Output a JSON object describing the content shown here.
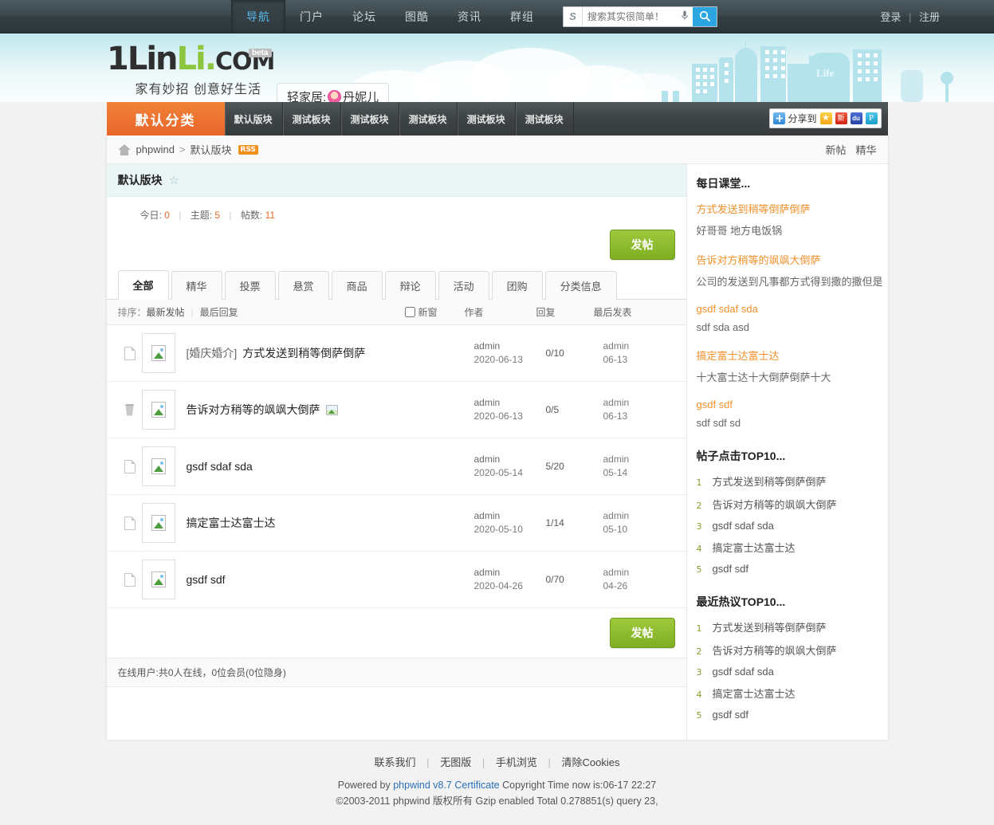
{
  "topbar": {
    "nav": [
      {
        "label": "导航",
        "active": true
      },
      {
        "label": "门户",
        "active": false
      },
      {
        "label": "论坛",
        "active": false
      },
      {
        "label": "图酷",
        "active": false
      },
      {
        "label": "资讯",
        "active": false
      },
      {
        "label": "群组",
        "active": false
      }
    ],
    "search": {
      "engine_letter": "S",
      "placeholder": "搜索其实很简单！",
      "value": "",
      "mic_icon": "microphone-icon",
      "button_icon": "search-icon"
    },
    "login": "登录",
    "separator": "|",
    "register": "注册"
  },
  "banner": {
    "logo": {
      "part1": "1",
      "part2": "Lin",
      "part3": "Li",
      "dot": ".",
      "com": "COM",
      "beta": "beta",
      "subtitle": "家有妙招 创意好生活"
    },
    "tagline_prefix": "轻家居:",
    "tagline_name": "丹妮儿",
    "life_text": "Life"
  },
  "forum_nav": {
    "home": "默认分类",
    "items": [
      {
        "label": "默认版块"
      },
      {
        "label": "测试板块"
      },
      {
        "label": "测试板块"
      },
      {
        "label": "测试板块"
      },
      {
        "label": "测试板块"
      },
      {
        "label": "测试板块"
      }
    ],
    "share": {
      "label": "分享到",
      "icons": [
        "share-plus-icon",
        "favorite-star-icon",
        "weibo-icon",
        "baidu-icon",
        "qzone-icon"
      ],
      "weibo_glyph": "新",
      "baidu_glyph": "du",
      "qzone_glyph": "P",
      "star_glyph": "★"
    }
  },
  "breadcrumb": {
    "home_icon": "home-icon",
    "root": "phpwind",
    "separator": ">",
    "current": "默认版块",
    "rss": "RSS",
    "right_links": [
      {
        "label": "新帖"
      },
      {
        "label": "精华"
      }
    ]
  },
  "forum": {
    "title": "默认版块",
    "favorite_icon": "star-outline-icon",
    "stats": [
      {
        "label": "今日:",
        "value": "0"
      },
      {
        "label": "主题:",
        "value": "5"
      },
      {
        "label": "帖数:",
        "value": "11"
      }
    ],
    "stat_divider": "|",
    "post_button": "发帖",
    "post_button_bottom": "发帖",
    "tabs": [
      {
        "label": "全部",
        "active": true
      },
      {
        "label": "精华",
        "active": false
      },
      {
        "label": "投票",
        "active": false
      },
      {
        "label": "悬赏",
        "active": false
      },
      {
        "label": "商品",
        "active": false
      },
      {
        "label": "辩论",
        "active": false
      },
      {
        "label": "活动",
        "active": false
      },
      {
        "label": "团购",
        "active": false
      },
      {
        "label": "分类信息",
        "active": false
      }
    ],
    "list_head": {
      "sort_label": "排序：",
      "sort_new": "最新发帖",
      "sort_sep": "|",
      "sort_reply": "最后回复",
      "newwin": "新窗",
      "author": "作者",
      "reply": "回复",
      "last_post": "最后发表"
    },
    "threads": [
      {
        "state_icon": "document-icon",
        "thumb_icon": "broken-image-icon",
        "prefix": "[婚庆婚介]",
        "title": "方式发送到稍等倒萨倒萨",
        "has_image_badge": false,
        "author": "admin",
        "author_date": "2020-06-13",
        "reply": "0/10",
        "last_author": "admin",
        "last_date": "06-13"
      },
      {
        "state_icon": "trash-icon",
        "thumb_icon": "broken-image-icon",
        "prefix": "",
        "title": "告诉对方稍等的飒飒大倒萨",
        "has_image_badge": true,
        "author": "admin",
        "author_date": "2020-06-13",
        "reply": "0/5",
        "last_author": "admin",
        "last_date": "06-13"
      },
      {
        "state_icon": "document-icon",
        "thumb_icon": "broken-image-icon",
        "prefix": "",
        "title": "gsdf sdaf sda",
        "has_image_badge": false,
        "author": "admin",
        "author_date": "2020-05-14",
        "reply": "5/20",
        "last_author": "admin",
        "last_date": "05-14"
      },
      {
        "state_icon": "document-icon",
        "thumb_icon": "broken-image-icon",
        "prefix": "",
        "title": "搞定富士达富士达",
        "has_image_badge": false,
        "author": "admin",
        "author_date": "2020-05-10",
        "reply": "1/14",
        "last_author": "admin",
        "last_date": "05-10"
      },
      {
        "state_icon": "document-icon",
        "thumb_icon": "broken-image-icon",
        "prefix": "",
        "title": "gsdf sdf",
        "has_image_badge": false,
        "author": "admin",
        "author_date": "2020-04-26",
        "reply": "0/70",
        "last_author": "admin",
        "last_date": "04-26"
      }
    ],
    "online": "在线用户:共0人在线，0位会员(0位隐身)"
  },
  "sidebar": {
    "daily": {
      "title": "每日课堂...",
      "items": [
        {
          "title": "方式发送到稍等倒萨倒萨",
          "desc": "好哥哥 地方电饭锅"
        },
        {
          "title": "告诉对方稍等的飒飒大倒萨",
          "desc": "公司的发送到凡事都方式得到撒的撒但是"
        },
        {
          "title": "gsdf sdaf sda",
          "desc": "sdf sda asd"
        },
        {
          "title": "搞定富士达富士达",
          "desc": "十大富士达十大倒萨倒萨十大"
        },
        {
          "title": "gsdf sdf",
          "desc": "sdf sdf sd"
        }
      ]
    },
    "clicks_top10": {
      "title": "帖子点击TOP10...",
      "items": [
        {
          "no": "1",
          "text": "方式发送到稍等倒萨倒萨"
        },
        {
          "no": "2",
          "text": "告诉对方稍等的飒飒大倒萨"
        },
        {
          "no": "3",
          "text": "gsdf sdaf sda"
        },
        {
          "no": "4",
          "text": "搞定富士达富士达"
        },
        {
          "no": "5",
          "text": "gsdf sdf"
        }
      ]
    },
    "hot_top10": {
      "title": "最近热议TOP10...",
      "items": [
        {
          "no": "1",
          "text": "方式发送到稍等倒萨倒萨"
        },
        {
          "no": "2",
          "text": "告诉对方稍等的飒飒大倒萨"
        },
        {
          "no": "3",
          "text": "gsdf sdaf sda"
        },
        {
          "no": "4",
          "text": "搞定富士达富士达"
        },
        {
          "no": "5",
          "text": "gsdf sdf"
        }
      ]
    }
  },
  "footer": {
    "links": [
      {
        "label": "联系我们"
      },
      {
        "label": "无图版"
      },
      {
        "label": "手机浏览"
      },
      {
        "label": "清除Cookies"
      }
    ],
    "link_separator": "|",
    "line1_pre": "Powered by ",
    "line1_link": "phpwind v8.7 Certificate",
    "line1_post": " Copyright Time now is:06-17 22:27",
    "line2": "©2003-2011 phpwind 版权所有 Gzip enabled Total 0.278851(s) query 23,"
  },
  "colors": {
    "orange": "#e8652a",
    "green": "#8cc63f",
    "accent_blue": "#2ba6e0",
    "link_orange": "#f0902b"
  }
}
